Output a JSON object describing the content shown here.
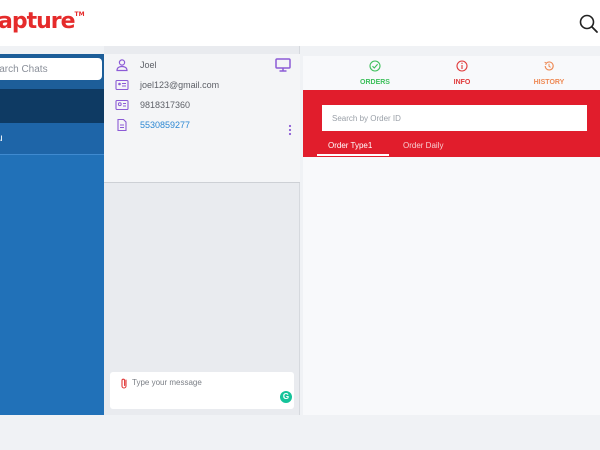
{
  "header": {
    "logo_text": "apture",
    "logo_mark": "TM"
  },
  "sidebar": {
    "search_placeholder": "Search Chats",
    "active_chat_label": "u"
  },
  "contact": {
    "name": "Joel",
    "email": "joel123@gmail.com",
    "phone": "9818317360",
    "id_number": "5530859277"
  },
  "chat": {
    "message_placeholder": "Type your message"
  },
  "tabs": [
    {
      "label": "ORDERS",
      "color": "#3cbf5a"
    },
    {
      "label": "INFO",
      "color": "#e03a3a"
    },
    {
      "label": "HISTORY",
      "color": "#ee8a55"
    }
  ],
  "orders": {
    "search_placeholder": "Search by Order ID",
    "tabs": [
      {
        "label": "Order Type1",
        "active": true
      },
      {
        "label": "Order Daily",
        "active": false
      }
    ]
  },
  "colors": {
    "brand_red": "#e11d2c",
    "sidebar_blue": "#2171b8",
    "icon_purple": "#8c5bd6",
    "link_blue": "#2b87d3"
  }
}
